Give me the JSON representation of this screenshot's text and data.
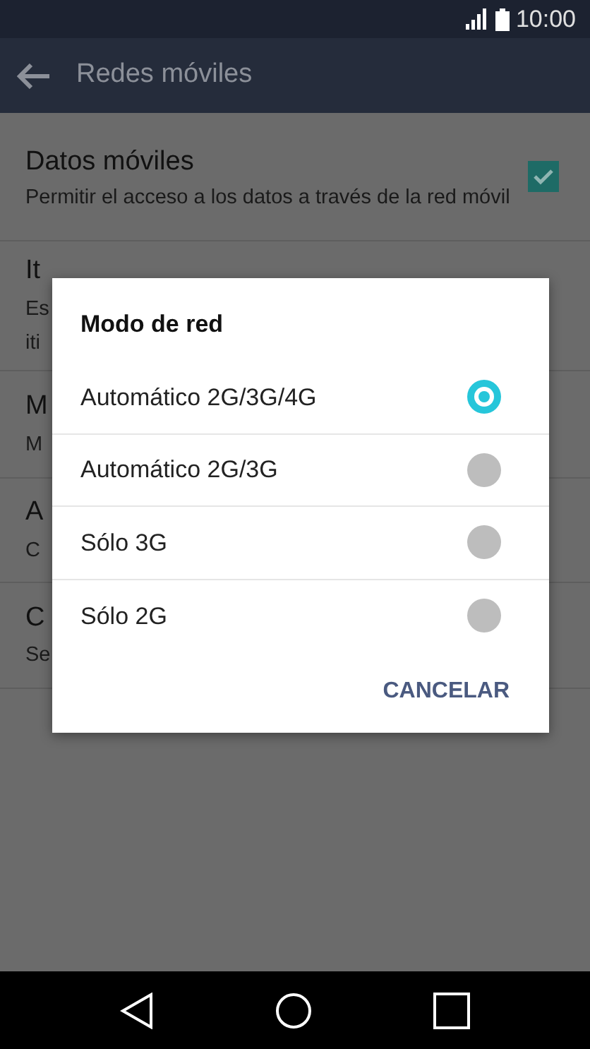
{
  "status_bar": {
    "time": "10:00"
  },
  "toolbar": {
    "title": "Redes móviles"
  },
  "settings": [
    {
      "title": "Datos móviles",
      "subtitle": "Permitir el acceso a los datos a través de la red móvil",
      "kind": "checkbox",
      "checked": true
    },
    {
      "title": "It",
      "subtitle_lines": [
        "Es",
        "iti"
      ],
      "kind": "covered"
    },
    {
      "title": "M",
      "subtitle_lines": [
        "M"
      ],
      "kind": "covered"
    },
    {
      "title": "A",
      "subtitle_lines": [
        "C"
      ],
      "kind": "covered"
    },
    {
      "title": "C",
      "subtitle_lines": [
        "Se"
      ],
      "kind": "covered"
    }
  ],
  "dialog": {
    "title": "Modo de red",
    "options": [
      {
        "label": "Automático 2G/3G/4G",
        "selected": true
      },
      {
        "label": "Automático 2G/3G",
        "selected": false
      },
      {
        "label": "Sólo 3G",
        "selected": false
      },
      {
        "label": "Sólo 2G",
        "selected": false
      }
    ],
    "button": "CANCELAR"
  }
}
